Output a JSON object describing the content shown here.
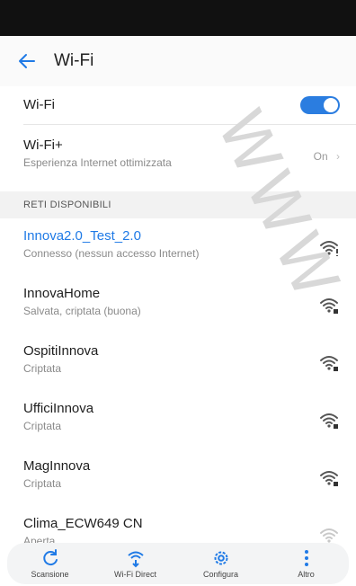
{
  "header": {
    "title": "Wi-Fi"
  },
  "wifi": {
    "label": "Wi-Fi",
    "enabled": true
  },
  "wifi_plus": {
    "label": "Wi-Fi+",
    "sublabel": "Esperienza Internet ottimizzata",
    "value": "On",
    "chevron": "›"
  },
  "section_title": "RETI DISPONIBILI",
  "networks": [
    {
      "name": "Innova2.0_Test_2.0",
      "status": "Connesso (nessun accesso Internet)",
      "connected": true,
      "icon": "wifi-no-internet-icon"
    },
    {
      "name": "InnovaHome",
      "status": "Salvata, criptata (buona)",
      "connected": false,
      "icon": "wifi-lock-icon"
    },
    {
      "name": "OspitiInnova",
      "status": "Criptata",
      "connected": false,
      "icon": "wifi-lock-icon"
    },
    {
      "name": "UfficiInnova",
      "status": "Criptata",
      "connected": false,
      "icon": "wifi-lock-icon"
    },
    {
      "name": "MagInnova",
      "status": "Criptata",
      "connected": false,
      "icon": "wifi-lock-icon"
    },
    {
      "name": "Clima_ECW649 CN",
      "status": "Aperta",
      "connected": false,
      "icon": "wifi-open-icon"
    }
  ],
  "bottom_tabs": [
    {
      "label": "Scansione",
      "icon": "refresh-icon"
    },
    {
      "label": "Wi-Fi Direct",
      "icon": "wifi-direct-icon"
    },
    {
      "label": "Configura",
      "icon": "gear-icon"
    },
    {
      "label": "Altro",
      "icon": "more-vertical-icon"
    }
  ],
  "colors": {
    "accent": "#1f7ae6",
    "connected_text": "#1f7ae6",
    "toggle_on": "#2b7de0"
  }
}
